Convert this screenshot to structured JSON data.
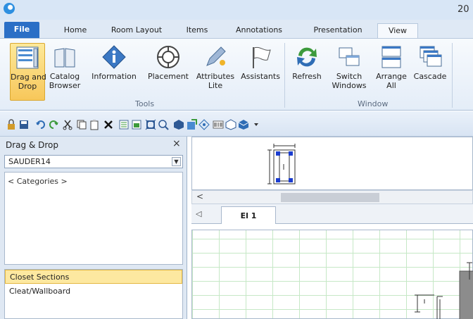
{
  "window": {
    "title": "20"
  },
  "tabs": [
    "File",
    "Home",
    "Room Layout",
    "Items",
    "Annotations",
    "Presentation",
    "View"
  ],
  "ribbon": {
    "tools": [
      {
        "line1": "Drag and",
        "line2": "Drop",
        "icon": "drag-drop-icon"
      },
      {
        "line1": "Catalog",
        "line2": "Browser",
        "icon": "book-icon"
      },
      {
        "line1": "Information",
        "line2": "",
        "icon": "info-icon"
      },
      {
        "line1": "Placement",
        "line2": "",
        "icon": "placement-icon"
      },
      {
        "line1": "Attributes",
        "line2": "Lite",
        "icon": "pencil-icon"
      },
      {
        "line1": "Assistants",
        "line2": "",
        "icon": "flag-icon"
      }
    ],
    "tools_group": "Tools",
    "window_buttons": [
      {
        "line1": "Refresh",
        "line2": "",
        "icon": "refresh-icon"
      },
      {
        "line1": "Switch",
        "line2": "Windows",
        "icon": "switch-windows-icon"
      },
      {
        "line1": "Arrange",
        "line2": "All",
        "icon": "arrange-icon"
      },
      {
        "line1": "Cascade",
        "line2": "",
        "icon": "cascade-icon"
      }
    ],
    "window_group": "Window"
  },
  "panel": {
    "title": "Drag & Drop",
    "close": "×",
    "catalog": "SAUDER14",
    "categories": "< Categories >",
    "items": [
      "Closet Sections",
      "Cleat/Wallboard"
    ]
  },
  "view": {
    "scroll_arrow": "<",
    "tab_nav": "◁",
    "tab_label": "El 1"
  },
  "colors": {
    "accent": "#2b6fc6",
    "selected": "#f7c75a",
    "grid": "#c6e8c6"
  }
}
